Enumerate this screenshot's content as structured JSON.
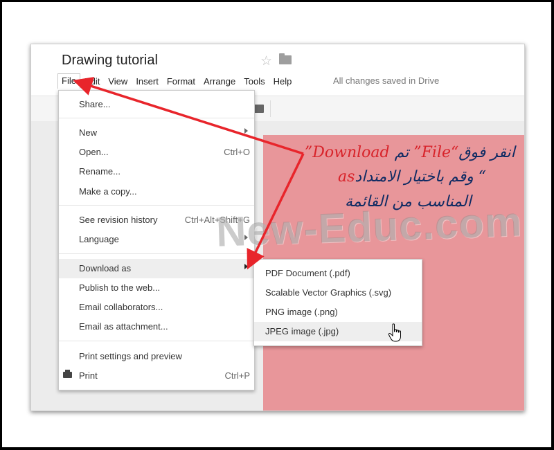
{
  "app": {
    "title": "Drawing tutorial",
    "save_status": "All changes saved in Drive"
  },
  "menubar": [
    "File",
    "Edit",
    "View",
    "Insert",
    "Format",
    "Arrange",
    "Tools",
    "Help"
  ],
  "file_menu": {
    "share": "Share...",
    "new": "New",
    "open": "Open...",
    "open_shortcut": "Ctrl+O",
    "rename": "Rename...",
    "make_copy": "Make a copy...",
    "revision_history": "See revision history",
    "revision_shortcut": "Ctrl+Alt+Shift+G",
    "language": "Language",
    "download_as": "Download as",
    "publish": "Publish to the web...",
    "email_collab": "Email collaborators...",
    "email_attach": "Email as attachment...",
    "print_settings": "Print settings and preview",
    "print": "Print",
    "print_shortcut": "Ctrl+P"
  },
  "download_menu": [
    "PDF Document (.pdf)",
    "Scalable Vector Graphics (.svg)",
    "PNG image (.png)",
    "JPEG image (.jpg)"
  ],
  "annotation": {
    "line1_ar_a": "انقر فوق",
    "line1_en_a": "“File”",
    "line1_ar_b": " تم ",
    "line1_en_b": "Download”",
    "line2_en": "as",
    "line2_ar": "“ وقم باختيار الامتداد",
    "line3_ar": "المناسب من القائمة"
  },
  "watermark": "New-Educ.com",
  "colors": {
    "canvas": "#e8969a",
    "arrow": "#e8252b",
    "annot_dark": "#0f2b63",
    "annot_red": "#d8232a"
  }
}
